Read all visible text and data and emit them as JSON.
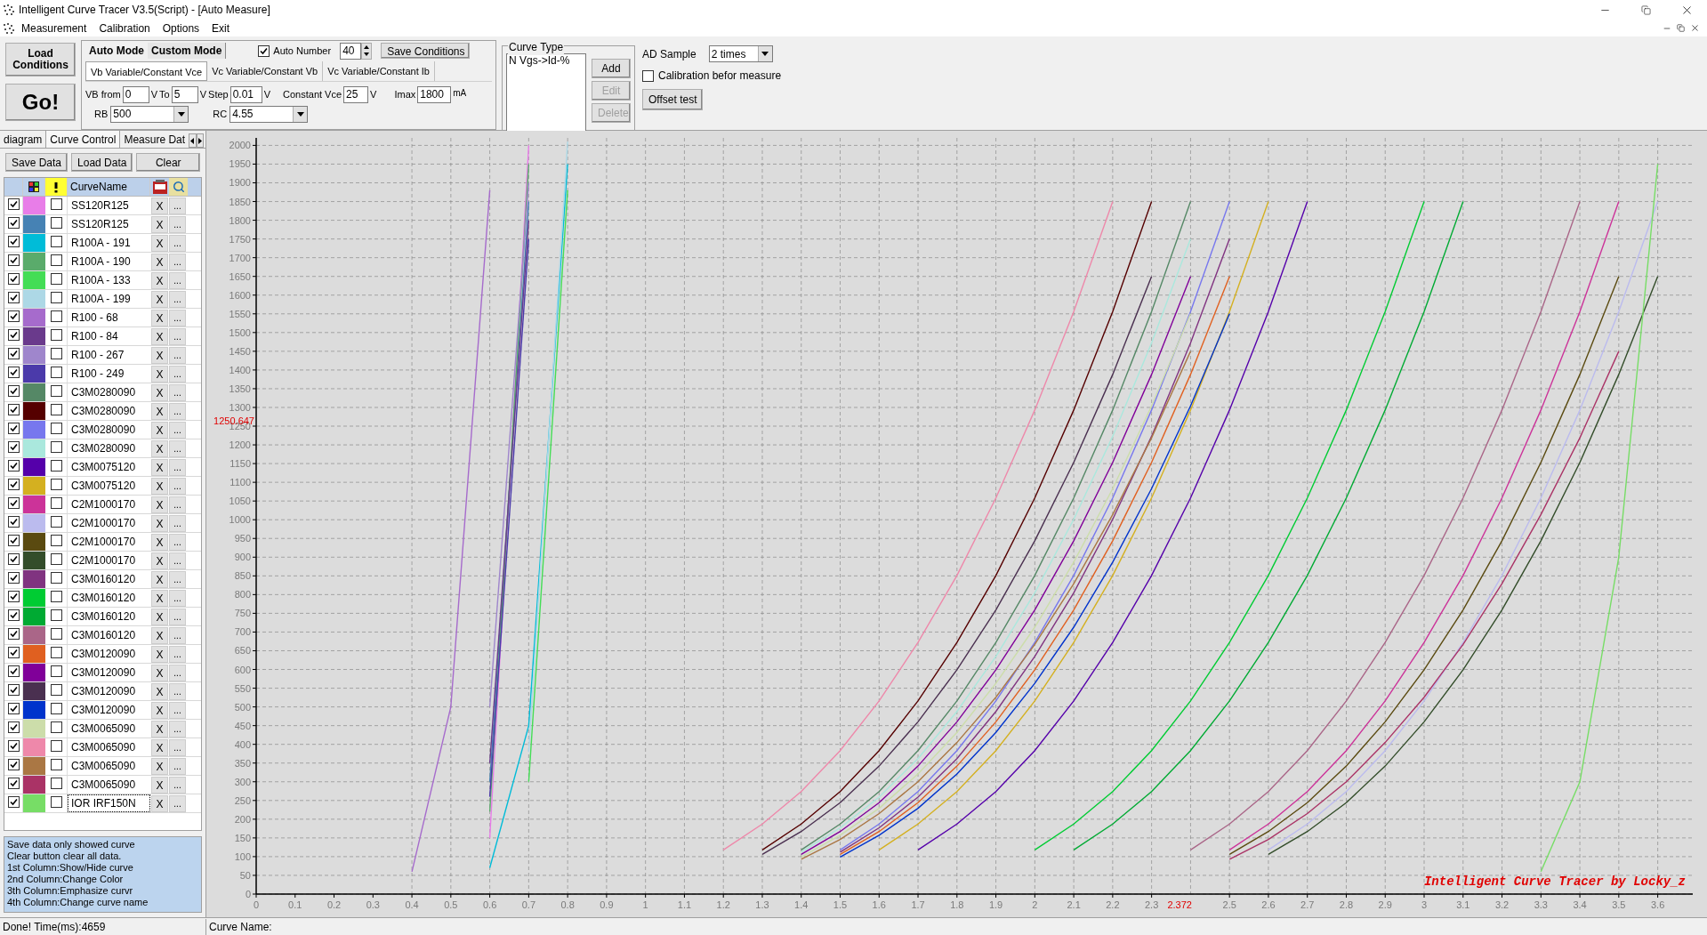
{
  "window": {
    "title": "Intelligent Curve Tracer V3.5(Script) - [Auto Measure]"
  },
  "menu": [
    {
      "label": "Measurement"
    },
    {
      "label": "Calibration"
    },
    {
      "label": "Options"
    },
    {
      "label": "Exit"
    }
  ],
  "toolbar": {
    "load_button": "Load Conditions",
    "go_button": "Go!",
    "mode_tabs": [
      {
        "label": "Auto Mode",
        "selected": true
      },
      {
        "label": "Custom Mode",
        "selected": false
      }
    ],
    "auto_number": {
      "label": "Auto Number",
      "checked": true,
      "value": "40"
    },
    "save_conditions": "Save Conditions",
    "sweep_tabs": [
      {
        "label": "Vb Variable/Constant Vce",
        "selected": true
      },
      {
        "label": "Vc Variable/Constant Vb",
        "selected": false
      },
      {
        "label": "Vc Variable/Constant Ib",
        "selected": false
      }
    ],
    "fields": [
      {
        "label": "VB from",
        "value": "0",
        "unit": "V"
      },
      {
        "label": "To",
        "value": "5",
        "unit": "V"
      },
      {
        "label": "Step",
        "value": "0.01",
        "unit": "V"
      },
      {
        "label": "Constant Vce",
        "value": "25",
        "unit": "V"
      },
      {
        "label": "Imax",
        "value": "1800",
        "unit": "mA"
      }
    ],
    "selects": [
      {
        "label": "RB",
        "value": "500"
      },
      {
        "label": "RC",
        "value": "4.55"
      }
    ],
    "curve_type": {
      "title": "Curve Type",
      "items": [
        "N Vgs->Id-%"
      ],
      "buttons": [
        {
          "label": "Add",
          "disabled": false
        },
        {
          "label": "Edit",
          "disabled": true
        },
        {
          "label": "Delete",
          "disabled": true
        }
      ]
    },
    "ad_sample": {
      "label": "AD Sample",
      "value": "2 times"
    },
    "calibration": {
      "label": "Calibration befor measure",
      "checked": false
    },
    "offset_test": "Offset test"
  },
  "side_panel": {
    "tabs": [
      {
        "label": "diagram",
        "selected": false
      },
      {
        "label": "Curve Control",
        "selected": true
      },
      {
        "label": "Measure Dat",
        "selected": false
      }
    ],
    "buttons": [
      "Save Data",
      "Load Data",
      "Clear"
    ],
    "header": "CurveName",
    "curves": [
      {
        "visible": true,
        "color": "#e87de8",
        "emphasized": false,
        "name": "SS120R125",
        "delete": "X",
        "rename": "...",
        "selected": false
      },
      {
        "visible": true,
        "color": "#4682b4",
        "emphasized": false,
        "name": "SS120R125",
        "delete": "X",
        "rename": "...",
        "selected": false
      },
      {
        "visible": true,
        "color": "#00bcd8",
        "emphasized": false,
        "name": "R100A - 191",
        "delete": "X",
        "rename": "...",
        "selected": false
      },
      {
        "visible": true,
        "color": "#5aab6b",
        "emphasized": false,
        "name": "R100A - 190",
        "delete": "X",
        "rename": "...",
        "selected": false
      },
      {
        "visible": true,
        "color": "#44dd55",
        "emphasized": false,
        "name": "R100A - 133",
        "delete": "X",
        "rename": "...",
        "selected": false
      },
      {
        "visible": true,
        "color": "#add8e6",
        "emphasized": false,
        "name": "R100A - 199",
        "delete": "X",
        "rename": "...",
        "selected": false
      },
      {
        "visible": true,
        "color": "#a66bcc",
        "emphasized": false,
        "name": "R100 - 68",
        "delete": "X",
        "rename": "...",
        "selected": false
      },
      {
        "visible": true,
        "color": "#6a3a8c",
        "emphasized": false,
        "name": "R100 - 84",
        "delete": "X",
        "rename": "...",
        "selected": false
      },
      {
        "visible": true,
        "color": "#9f86cc",
        "emphasized": false,
        "name": "R100 - 267",
        "delete": "X",
        "rename": "...",
        "selected": false
      },
      {
        "visible": true,
        "color": "#4b3aaa",
        "emphasized": false,
        "name": "R100 - 249",
        "delete": "X",
        "rename": "...",
        "selected": false
      },
      {
        "visible": true,
        "color": "#558866",
        "emphasized": false,
        "name": "C3M0280090",
        "delete": "X",
        "rename": "...",
        "selected": false
      },
      {
        "visible": true,
        "color": "#550000",
        "emphasized": false,
        "name": "C3M0280090",
        "delete": "X",
        "rename": "...",
        "selected": false
      },
      {
        "visible": true,
        "color": "#7777ee",
        "emphasized": false,
        "name": "C3M0280090",
        "delete": "X",
        "rename": "...",
        "selected": false
      },
      {
        "visible": true,
        "color": "#aae8dd",
        "emphasized": false,
        "name": "C3M0280090",
        "delete": "X",
        "rename": "...",
        "selected": false
      },
      {
        "visible": true,
        "color": "#5500aa",
        "emphasized": false,
        "name": "C3M0075120",
        "delete": "X",
        "rename": "...",
        "selected": false
      },
      {
        "visible": true,
        "color": "#d4b020",
        "emphasized": false,
        "name": "C3M0075120",
        "delete": "X",
        "rename": "...",
        "selected": false
      },
      {
        "visible": true,
        "color": "#cc3399",
        "emphasized": false,
        "name": "C2M1000170",
        "delete": "X",
        "rename": "...",
        "selected": false
      },
      {
        "visible": true,
        "color": "#bbbbee",
        "emphasized": false,
        "name": "C2M1000170",
        "delete": "X",
        "rename": "...",
        "selected": false
      },
      {
        "visible": true,
        "color": "#5a4a10",
        "emphasized": false,
        "name": "C2M1000170",
        "delete": "X",
        "rename": "...",
        "selected": false
      },
      {
        "visible": true,
        "color": "#334d2a",
        "emphasized": false,
        "name": "C2M1000170",
        "delete": "X",
        "rename": "...",
        "selected": false
      },
      {
        "visible": true,
        "color": "#803380",
        "emphasized": false,
        "name": "C3M0160120",
        "delete": "X",
        "rename": "...",
        "selected": false
      },
      {
        "visible": true,
        "color": "#00cc33",
        "emphasized": false,
        "name": "C3M0160120",
        "delete": "X",
        "rename": "...",
        "selected": false
      },
      {
        "visible": true,
        "color": "#00aa33",
        "emphasized": false,
        "name": "C3M0160120",
        "delete": "X",
        "rename": "...",
        "selected": false
      },
      {
        "visible": true,
        "color": "#aa6688",
        "emphasized": false,
        "name": "C3M0160120",
        "delete": "X",
        "rename": "...",
        "selected": false
      },
      {
        "visible": true,
        "color": "#e06020",
        "emphasized": false,
        "name": "C3M0120090",
        "delete": "X",
        "rename": "...",
        "selected": false
      },
      {
        "visible": true,
        "color": "#800099",
        "emphasized": false,
        "name": "C3M0120090",
        "delete": "X",
        "rename": "...",
        "selected": false
      },
      {
        "visible": true,
        "color": "#4a3050",
        "emphasized": false,
        "name": "C3M0120090",
        "delete": "X",
        "rename": "...",
        "selected": false
      },
      {
        "visible": true,
        "color": "#0033cc",
        "emphasized": false,
        "name": "C3M0120090",
        "delete": "X",
        "rename": "...",
        "selected": false
      },
      {
        "visible": true,
        "color": "#ccddaa",
        "emphasized": false,
        "name": "C3M0065090",
        "delete": "X",
        "rename": "...",
        "selected": false
      },
      {
        "visible": true,
        "color": "#ee88aa",
        "emphasized": false,
        "name": "C3M0065090",
        "delete": "X",
        "rename": "...",
        "selected": false
      },
      {
        "visible": true,
        "color": "#aa7744",
        "emphasized": false,
        "name": "C3M0065090",
        "delete": "X",
        "rename": "...",
        "selected": false
      },
      {
        "visible": true,
        "color": "#aa3366",
        "emphasized": false,
        "name": "C3M0065090",
        "delete": "X",
        "rename": "...",
        "selected": false
      },
      {
        "visible": true,
        "color": "#77dd66",
        "emphasized": false,
        "name": "IOR IRF150N",
        "delete": "X",
        "rename": "...",
        "selected": true
      }
    ],
    "notes": [
      "Save data only showed curve",
      "Clear button clear all data.",
      "1st Column:Show/Hide curve",
      "2nd Column:Change Color",
      "3th Column:Emphasize curvr",
      "4th Column:Change curve name"
    ]
  },
  "chart": {
    "credit": "Intelligent Curve Tracer by Locky_z",
    "cursor": {
      "y_readout": "1250.647",
      "x_readout": "2.372"
    },
    "chart_data": {
      "type": "line",
      "grid": true,
      "x": [
        0.4,
        0.5,
        0.6,
        0.7,
        0.8,
        0.9,
        1,
        1.1,
        1.2,
        1.3,
        1.4,
        1.5,
        1.6,
        1.7,
        1.8,
        1.9,
        2,
        2.1,
        2.2,
        2.3,
        2.4,
        2.5,
        2.6,
        2.7,
        2.8,
        2.9,
        3,
        3.1,
        3.2,
        3.3,
        3.4,
        3.5,
        3.6
      ],
      "xlim": [
        0,
        3.69
      ],
      "ylim": [
        0,
        2020
      ],
      "xticks": [
        0,
        0.1,
        0.2,
        0.3,
        0.4,
        0.5,
        0.6,
        0.7,
        0.8,
        0.9,
        1,
        1.1,
        1.2,
        1.3,
        1.4,
        1.5,
        1.6,
        1.7,
        1.8,
        1.9,
        2,
        2.1,
        2.2,
        2.3,
        2.5,
        2.6,
        2.7,
        2.8,
        2.9,
        3,
        3.1,
        3.2,
        3.3,
        3.4,
        3.5,
        3.6
      ],
      "yticks": [
        0,
        50,
        100,
        150,
        200,
        250,
        300,
        350,
        400,
        450,
        500,
        550,
        600,
        650,
        700,
        750,
        800,
        850,
        900,
        950,
        1000,
        1050,
        1100,
        1150,
        1200,
        1250,
        1300,
        1350,
        1400,
        1450,
        1500,
        1550,
        1600,
        1650,
        1700,
        1750,
        1800,
        1850,
        1900,
        1950,
        2000
      ],
      "series": [
        {
          "color": "#e87de8",
          "values": [
            null,
            null,
            150,
            2000,
            null,
            null,
            null,
            null,
            null,
            null,
            null,
            null,
            null,
            null,
            null,
            null,
            null,
            null,
            null,
            null,
            null,
            null,
            null,
            null,
            null,
            null,
            null,
            null,
            null,
            null,
            null,
            null,
            null
          ]
        },
        {
          "color": "#4682b4",
          "values": [
            null,
            null,
            300,
            1850,
            null,
            null,
            null,
            null,
            null,
            null,
            null,
            null,
            null,
            null,
            null,
            null,
            null,
            null,
            null,
            null,
            null,
            null,
            null,
            null,
            null,
            null,
            null,
            null,
            null,
            null,
            null,
            null,
            null
          ]
        },
        {
          "color": "#00bcd8",
          "values": [
            null,
            null,
            70,
            450,
            1950,
            null,
            null,
            null,
            null,
            null,
            null,
            null,
            null,
            null,
            null,
            null,
            null,
            null,
            null,
            null,
            null,
            null,
            null,
            null,
            null,
            null,
            null,
            null,
            null,
            null,
            null,
            null,
            null
          ]
        },
        {
          "color": "#5aab6b",
          "values": [
            null,
            null,
            220,
            1950,
            null,
            null,
            null,
            null,
            null,
            null,
            null,
            null,
            null,
            null,
            null,
            null,
            null,
            null,
            null,
            null,
            null,
            null,
            null,
            null,
            null,
            null,
            null,
            null,
            null,
            null,
            null,
            null,
            null
          ]
        },
        {
          "color": "#44dd55",
          "values": [
            null,
            null,
            null,
            300,
            1880,
            null,
            null,
            null,
            null,
            null,
            null,
            null,
            null,
            null,
            null,
            null,
            null,
            null,
            null,
            null,
            null,
            null,
            null,
            null,
            null,
            null,
            null,
            null,
            null,
            null,
            null,
            null,
            null
          ]
        },
        {
          "color": "#add8e6",
          "values": [
            null,
            null,
            null,
            380,
            2010,
            null,
            null,
            null,
            null,
            null,
            null,
            null,
            null,
            null,
            null,
            null,
            null,
            null,
            null,
            null,
            null,
            null,
            null,
            null,
            null,
            null,
            null,
            null,
            null,
            null,
            null,
            null,
            null
          ]
        },
        {
          "color": "#a66bcc",
          "values": [
            60,
            500,
            1880,
            null,
            null,
            null,
            null,
            null,
            null,
            null,
            null,
            null,
            null,
            null,
            null,
            null,
            null,
            null,
            null,
            null,
            null,
            null,
            null,
            null,
            null,
            null,
            null,
            null,
            null,
            null,
            null,
            null,
            null
          ]
        },
        {
          "color": "#6a3a8c",
          "values": [
            null,
            null,
            350,
            1800,
            null,
            null,
            null,
            null,
            null,
            null,
            null,
            null,
            null,
            null,
            null,
            null,
            null,
            null,
            null,
            null,
            null,
            null,
            null,
            null,
            null,
            null,
            null,
            null,
            null,
            null,
            null,
            null,
            null
          ]
        },
        {
          "color": "#9f86cc",
          "values": [
            null,
            null,
            500,
            1900,
            null,
            null,
            null,
            null,
            null,
            null,
            null,
            null,
            null,
            null,
            null,
            null,
            null,
            null,
            null,
            null,
            null,
            null,
            null,
            null,
            null,
            null,
            null,
            null,
            null,
            null,
            null,
            null,
            null
          ]
        },
        {
          "color": "#4b3aaa",
          "values": [
            null,
            null,
            260,
            1750,
            null,
            null,
            null,
            null,
            null,
            null,
            null,
            null,
            null,
            null,
            null,
            null,
            null,
            null,
            null,
            null,
            null,
            null,
            null,
            null,
            null,
            null,
            null,
            null,
            null,
            null,
            null,
            null,
            null
          ]
        },
        {
          "color": "#558866",
          "values": [
            null,
            null,
            null,
            null,
            null,
            null,
            null,
            null,
            null,
            null,
            118,
            187,
            274,
            383,
            516,
            672,
            851,
            1058,
            1293,
            1556,
            1850,
            null,
            null,
            null,
            null,
            null,
            null,
            null,
            null,
            null,
            null,
            null,
            null
          ]
        },
        {
          "color": "#550000",
          "values": [
            null,
            null,
            null,
            null,
            null,
            null,
            null,
            null,
            null,
            118,
            187,
            274,
            383,
            516,
            672,
            851,
            1058,
            1293,
            1556,
            1850,
            null,
            null,
            null,
            null,
            null,
            null,
            null,
            null,
            null,
            null,
            null,
            null,
            null
          ]
        },
        {
          "color": "#7777ee",
          "values": [
            null,
            null,
            null,
            null,
            null,
            null,
            null,
            null,
            null,
            null,
            null,
            118,
            187,
            274,
            383,
            516,
            672,
            851,
            1058,
            1293,
            1556,
            1850,
            null,
            null,
            null,
            null,
            null,
            null,
            null,
            null,
            null,
            null,
            null
          ]
        },
        {
          "color": "#aae8dd",
          "values": [
            null,
            null,
            null,
            null,
            null,
            null,
            null,
            null,
            null,
            null,
            112,
            177,
            259,
            362,
            488,
            635,
            805,
            1001,
            1223,
            1472,
            1750,
            null,
            null,
            null,
            null,
            null,
            null,
            null,
            null,
            null,
            null,
            null,
            null
          ]
        },
        {
          "color": "#5500aa",
          "values": [
            null,
            null,
            null,
            null,
            null,
            null,
            null,
            null,
            null,
            null,
            null,
            null,
            null,
            118,
            187,
            274,
            383,
            516,
            672,
            851,
            1058,
            1293,
            1556,
            1850,
            null,
            null,
            null,
            null,
            null,
            null,
            null,
            null,
            null
          ]
        },
        {
          "color": "#d4b020",
          "values": [
            null,
            null,
            null,
            null,
            null,
            null,
            null,
            null,
            null,
            null,
            null,
            null,
            118,
            187,
            274,
            383,
            516,
            672,
            851,
            1058,
            1293,
            1556,
            1850,
            null,
            null,
            null,
            null,
            null,
            null,
            null,
            null,
            null,
            null
          ]
        },
        {
          "color": "#cc3399",
          "values": [
            null,
            null,
            null,
            null,
            null,
            null,
            null,
            null,
            null,
            null,
            null,
            null,
            null,
            null,
            null,
            null,
            null,
            null,
            null,
            null,
            null,
            118,
            187,
            274,
            383,
            516,
            672,
            851,
            1058,
            1293,
            1556,
            1850,
            null
          ]
        },
        {
          "color": "#bbbbee",
          "values": [
            null,
            null,
            null,
            null,
            null,
            null,
            null,
            null,
            null,
            null,
            null,
            null,
            null,
            null,
            null,
            null,
            null,
            null,
            null,
            null,
            null,
            null,
            118,
            187,
            274,
            383,
            516,
            672,
            851,
            1058,
            1293,
            1556,
            1850
          ]
        },
        {
          "color": "#5a4a10",
          "values": [
            null,
            null,
            null,
            null,
            null,
            null,
            null,
            null,
            null,
            null,
            null,
            null,
            null,
            null,
            null,
            null,
            null,
            null,
            null,
            null,
            null,
            106,
            167,
            244,
            342,
            460,
            599,
            759,
            944,
            1153,
            1388,
            1650,
            null
          ]
        },
        {
          "color": "#334d2a",
          "values": [
            null,
            null,
            null,
            null,
            null,
            null,
            null,
            null,
            null,
            null,
            null,
            null,
            null,
            null,
            null,
            null,
            null,
            null,
            null,
            null,
            null,
            null,
            106,
            167,
            244,
            342,
            460,
            599,
            759,
            944,
            1153,
            1388,
            1650
          ]
        },
        {
          "color": "#803380",
          "values": [
            null,
            null,
            null,
            null,
            null,
            null,
            null,
            null,
            null,
            null,
            null,
            112,
            177,
            259,
            362,
            488,
            635,
            805,
            1001,
            1223,
            1472,
            1750,
            null,
            null,
            null,
            null,
            null,
            null,
            null,
            null,
            null,
            null,
            null
          ]
        },
        {
          "color": "#00cc33",
          "values": [
            null,
            null,
            null,
            null,
            null,
            null,
            null,
            null,
            null,
            null,
            null,
            null,
            null,
            null,
            null,
            null,
            118,
            187,
            274,
            383,
            516,
            672,
            851,
            1058,
            1293,
            1556,
            1850,
            null,
            null,
            null,
            null,
            null,
            null
          ]
        },
        {
          "color": "#00aa33",
          "values": [
            null,
            null,
            null,
            null,
            null,
            null,
            null,
            null,
            null,
            null,
            null,
            null,
            null,
            null,
            null,
            null,
            null,
            118,
            187,
            274,
            383,
            516,
            672,
            851,
            1058,
            1293,
            1556,
            1850,
            null,
            null,
            null,
            null,
            null
          ]
        },
        {
          "color": "#aa6688",
          "values": [
            null,
            null,
            null,
            null,
            null,
            null,
            null,
            null,
            null,
            null,
            null,
            null,
            null,
            null,
            null,
            null,
            null,
            null,
            null,
            null,
            118,
            187,
            274,
            383,
            516,
            672,
            851,
            1058,
            1293,
            1556,
            1850,
            null,
            null
          ]
        },
        {
          "color": "#e06020",
          "values": [
            null,
            null,
            null,
            null,
            null,
            null,
            null,
            null,
            null,
            null,
            null,
            106,
            167,
            244,
            342,
            460,
            599,
            759,
            944,
            1153,
            1388,
            1650,
            null,
            null,
            null,
            null,
            null,
            null,
            null,
            null,
            null,
            null,
            null
          ]
        },
        {
          "color": "#800099",
          "values": [
            null,
            null,
            null,
            null,
            null,
            null,
            null,
            null,
            null,
            null,
            106,
            167,
            244,
            342,
            460,
            599,
            759,
            944,
            1153,
            1388,
            1650,
            null,
            null,
            null,
            null,
            null,
            null,
            null,
            null,
            null,
            null,
            null,
            null
          ]
        },
        {
          "color": "#4a3050",
          "values": [
            null,
            null,
            null,
            null,
            null,
            null,
            null,
            null,
            null,
            106,
            167,
            244,
            342,
            460,
            599,
            759,
            944,
            1153,
            1388,
            1650,
            null,
            null,
            null,
            null,
            null,
            null,
            null,
            null,
            null,
            null,
            null,
            null,
            null
          ]
        },
        {
          "color": "#0033cc",
          "values": [
            null,
            null,
            null,
            null,
            null,
            null,
            null,
            null,
            null,
            null,
            null,
            99,
            157,
            229,
            321,
            432,
            563,
            713,
            887,
            1083,
            1304,
            1550,
            null,
            null,
            null,
            null,
            null,
            null,
            null,
            null,
            null,
            null,
            null
          ]
        },
        {
          "color": "#ccddaa",
          "values": [
            null,
            null,
            null,
            null,
            null,
            null,
            null,
            null,
            null,
            null,
            99,
            157,
            229,
            321,
            432,
            563,
            713,
            887,
            1083,
            1304,
            1550,
            null,
            null,
            null,
            null,
            null,
            null,
            null,
            null,
            null,
            null,
            null,
            null
          ]
        },
        {
          "color": "#ee88aa",
          "values": [
            null,
            null,
            null,
            null,
            null,
            null,
            null,
            null,
            118,
            187,
            274,
            383,
            516,
            672,
            851,
            1058,
            1293,
            1556,
            1850,
            null,
            null,
            null,
            null,
            null,
            null,
            null,
            null,
            null,
            null,
            null,
            null,
            null,
            null
          ]
        },
        {
          "color": "#aa7744",
          "values": [
            null,
            null,
            null,
            null,
            null,
            null,
            null,
            null,
            null,
            null,
            93,
            146,
            215,
            300,
            405,
            526,
            667,
            829,
            1014,
            1219,
            1450,
            null,
            null,
            null,
            null,
            null,
            null,
            null,
            null,
            null,
            null,
            null,
            null
          ]
        },
        {
          "color": "#aa3366",
          "values": [
            null,
            null,
            null,
            null,
            null,
            null,
            null,
            null,
            null,
            null,
            null,
            null,
            null,
            null,
            null,
            null,
            null,
            null,
            null,
            null,
            null,
            93,
            146,
            215,
            300,
            405,
            526,
            667,
            829,
            1014,
            1219,
            1450,
            null
          ]
        },
        {
          "color": "#77dd66",
          "values": [
            null,
            null,
            null,
            null,
            null,
            null,
            null,
            null,
            null,
            null,
            null,
            null,
            null,
            null,
            null,
            null,
            null,
            null,
            null,
            null,
            null,
            null,
            null,
            null,
            null,
            null,
            null,
            null,
            null,
            60,
            300,
            900,
            1950
          ]
        }
      ]
    }
  },
  "status_bar": {
    "message": "Done! Time(ms):4659",
    "curve_name": "Curve Name:"
  }
}
